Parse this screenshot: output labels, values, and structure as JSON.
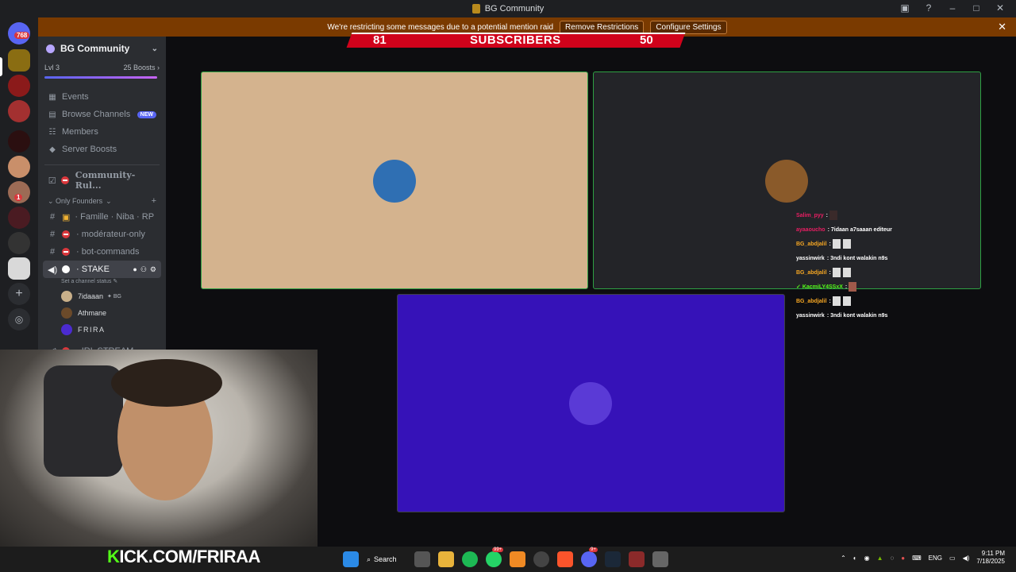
{
  "window": {
    "title": "BG Community"
  },
  "banner": {
    "message": "We're restricting some messages due to a potential mention raid",
    "remove_label": "Remove Restrictions",
    "configure_label": "Configure Settings"
  },
  "overlay": {
    "count_left": "81",
    "label": "SUBSCRIBERS",
    "count_right": "50",
    "kick_prefix": "K",
    "kick_url": "ICK.COM/FRIRAA"
  },
  "rail": {
    "mention_badge": "768",
    "badge_small": "1"
  },
  "server": {
    "name": "BG Community",
    "level": "Lvl 3",
    "boosts": "25 Boosts",
    "boost_progress": 0.98
  },
  "nav": [
    {
      "label": "Events",
      "icon": "calendar-icon"
    },
    {
      "label": "Browse Channels",
      "icon": "browse-icon",
      "badge": "NEW"
    },
    {
      "label": "Members",
      "icon": "members-icon"
    },
    {
      "label": "Server Boosts",
      "icon": "boost-icon"
    }
  ],
  "channels": {
    "rules": "Community-Rul...",
    "category": "Only Founders",
    "famille": "Famille",
    "niba": "Niba",
    "rp": "RP",
    "moderateur": "modérateur-only",
    "bot": "bot-commands",
    "stake": "STAKE",
    "stake_status": "Set a channel status",
    "irl": "IRL STREAM"
  },
  "members": [
    {
      "name": "7idaaan",
      "tag": "BG"
    },
    {
      "name": "Athmane",
      "tag": ""
    },
    {
      "name": "FRIRA",
      "tag": ""
    }
  ],
  "chat": [
    {
      "user": "Salim_pyy",
      "text": "",
      "color": "#e91e63",
      "emotes": 1
    },
    {
      "user": "ayaaoucho",
      "text": "7idaan a7saaan editeur",
      "color": "#e91e63",
      "emotes": 0
    },
    {
      "user": "BG_abdjalil",
      "text": "",
      "color": "#f5a623",
      "emotes": 2
    },
    {
      "user": "yassinwirk",
      "text": "3ndi kont walakin n9s",
      "color": "#dbdee1",
      "emotes": 0
    },
    {
      "user": "BG_abdjalil",
      "text": "",
      "color": "#f5a623",
      "emotes": 2
    },
    {
      "user": "KacmiLY4SSxX",
      "text": "",
      "color": "#53fc18",
      "emotes": 1
    },
    {
      "user": "BG_abdjalil",
      "text": "",
      "color": "#f5a623",
      "emotes": 2
    },
    {
      "user": "yassinwirk",
      "text": "3ndi kont walakin n9s",
      "color": "#dbdee1",
      "emotes": 0
    }
  ],
  "taskbar": {
    "search_label": "Search",
    "badge_whatsapp": "99+",
    "badge_discord": "9+",
    "lang": "ENG",
    "time": "9:11 PM",
    "date": "7/18/2025"
  },
  "colors": {
    "tile_tan": "#d4b38e",
    "tile_dark": "#232428",
    "tile_purple": "#3612b8",
    "speaking_border": "#2ea043",
    "kick_green": "#53fc18",
    "sub_red": "#d0021b"
  }
}
